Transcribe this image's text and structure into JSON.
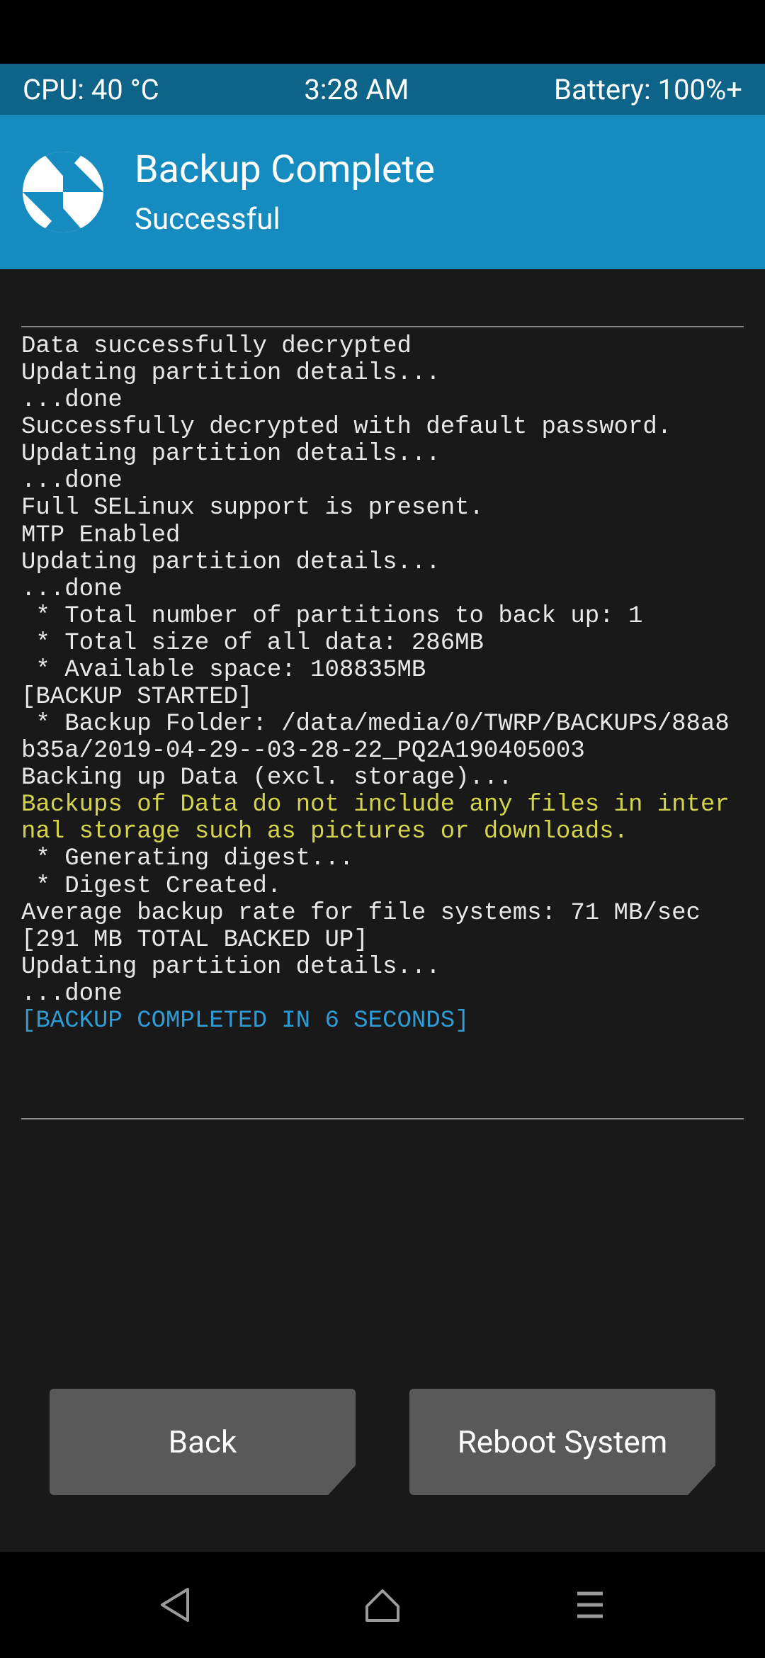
{
  "status": {
    "cpu": "CPU: 40 °C",
    "time": "3:28 AM",
    "battery": "Battery: 100%+"
  },
  "header": {
    "title": "Backup Complete",
    "subtitle": "Successful"
  },
  "log": [
    {
      "t": "Data successfully decrypted",
      "c": ""
    },
    {
      "t": "Updating partition details...",
      "c": ""
    },
    {
      "t": "...done",
      "c": ""
    },
    {
      "t": "Successfully decrypted with default password.",
      "c": ""
    },
    {
      "t": "Updating partition details...",
      "c": ""
    },
    {
      "t": "...done",
      "c": ""
    },
    {
      "t": "Full SELinux support is present.",
      "c": ""
    },
    {
      "t": "MTP Enabled",
      "c": ""
    },
    {
      "t": "Updating partition details...",
      "c": ""
    },
    {
      "t": "...done",
      "c": ""
    },
    {
      "t": " * Total number of partitions to back up: 1",
      "c": ""
    },
    {
      "t": " * Total size of all data: 286MB",
      "c": ""
    },
    {
      "t": " * Available space: 108835MB",
      "c": ""
    },
    {
      "t": "[BACKUP STARTED]",
      "c": ""
    },
    {
      "t": " * Backup Folder: /data/media/0/TWRP/BACKUPS/88a8b35a/2019-04-29--03-28-22_PQ2A190405003",
      "c": ""
    },
    {
      "t": "Backing up Data (excl. storage)...",
      "c": ""
    },
    {
      "t": "Backups of Data do not include any files in internal storage such as pictures or downloads.",
      "c": "c-yellow"
    },
    {
      "t": " * Generating digest...",
      "c": ""
    },
    {
      "t": " * Digest Created.",
      "c": ""
    },
    {
      "t": "Average backup rate for file systems: 71 MB/sec",
      "c": ""
    },
    {
      "t": "[291 MB TOTAL BACKED UP]",
      "c": ""
    },
    {
      "t": "Updating partition details...",
      "c": ""
    },
    {
      "t": "...done",
      "c": ""
    },
    {
      "t": "[BACKUP COMPLETED IN 6 SECONDS]",
      "c": "c-blue"
    }
  ],
  "buttons": {
    "back": "Back",
    "reboot": "Reboot System"
  }
}
